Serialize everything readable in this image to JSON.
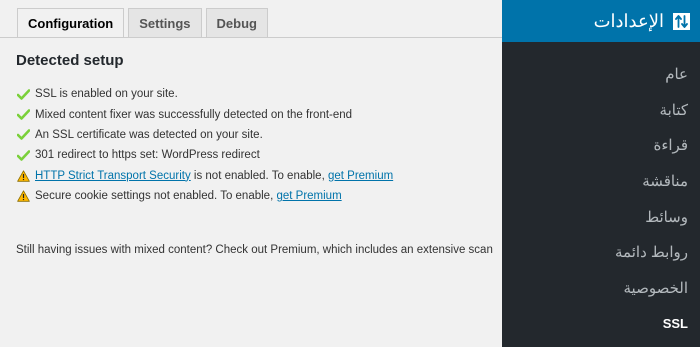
{
  "tabs": [
    {
      "label": "Configuration",
      "active": true
    },
    {
      "label": "Settings",
      "active": false
    },
    {
      "label": "Debug",
      "active": false
    }
  ],
  "section_title": "Detected setup",
  "items": [
    {
      "status": "ok",
      "icon": "check-icon",
      "text": "SSL is enabled on your site."
    },
    {
      "status": "ok",
      "icon": "check-icon",
      "text": "Mixed content fixer was successfully detected on the front-end"
    },
    {
      "status": "ok",
      "icon": "check-icon",
      "text": "An SSL certificate was detected on your site."
    },
    {
      "status": "ok",
      "icon": "check-icon",
      "text": "301 redirect to https set: WordPress redirect"
    },
    {
      "status": "warning",
      "icon": "warning-icon",
      "link_text": "HTTP Strict Transport Security",
      "text": " is not enabled. To enable, ",
      "link2_text": "get Premium"
    },
    {
      "status": "warning",
      "icon": "warning-icon",
      "text": "Secure cookie settings not enabled. To enable, ",
      "link2_text": "get Premium"
    }
  ],
  "bottom_note": "Still having issues with mixed content? Check out Premium, which includes an extensive scan",
  "sidebar": {
    "header_title": "الإعدادات",
    "header_icon": "sliders-icon",
    "items": [
      {
        "label": "عام"
      },
      {
        "label": "كتابة"
      },
      {
        "label": "قراءة"
      },
      {
        "label": "مناقشة"
      },
      {
        "label": "وسائط"
      },
      {
        "label": "روابط دائمة"
      },
      {
        "label": "الخصوصية"
      },
      {
        "label": "SSL",
        "current": true
      }
    ]
  },
  "colors": {
    "accent": "#0073aa",
    "sidebar_bg": "#23282d",
    "check": "#7ad03a",
    "warning": "#ffb900",
    "link": "#0073aa"
  }
}
